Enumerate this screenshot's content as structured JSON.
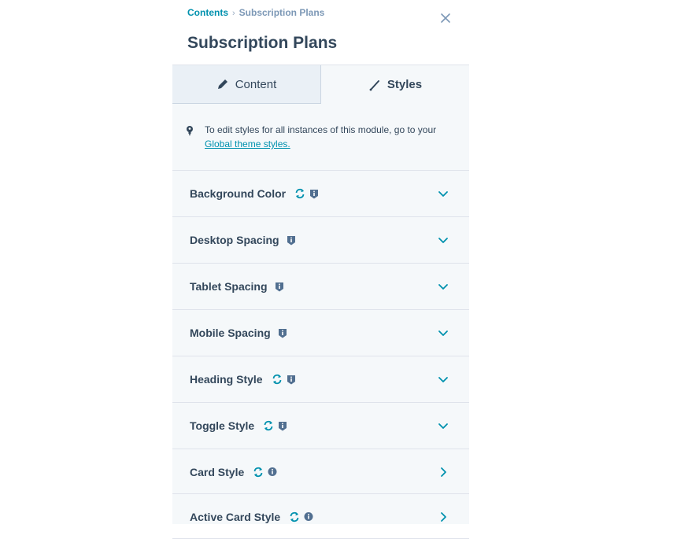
{
  "breadcrumb": {
    "parent": "Contents",
    "separator": "›",
    "current": "Subscription Plans"
  },
  "title": "Subscription Plans",
  "close_icon": "close-icon",
  "tabs": [
    {
      "label": "Content",
      "icon": "pencil-icon",
      "active": false
    },
    {
      "label": "Styles",
      "icon": "brush-icon",
      "active": true
    }
  ],
  "notice": {
    "icon": "lightbulb-icon",
    "text": "To edit styles for all instances of this module, go to your ",
    "link": "Global theme styles."
  },
  "sections": [
    {
      "label": "Background Color",
      "sync": true,
      "info": true,
      "expand": "chevron-down"
    },
    {
      "label": "Desktop Spacing",
      "sync": false,
      "info": true,
      "expand": "chevron-down"
    },
    {
      "label": "Tablet Spacing",
      "sync": false,
      "info": true,
      "expand": "chevron-down"
    },
    {
      "label": "Mobile Spacing",
      "sync": false,
      "info": true,
      "expand": "chevron-down"
    },
    {
      "label": "Heading Style",
      "sync": true,
      "info": true,
      "expand": "chevron-down"
    },
    {
      "label": "Toggle Style",
      "sync": true,
      "info": true,
      "expand": "chevron-down"
    },
    {
      "label": "Card Style",
      "sync": true,
      "info": true,
      "expand": "chevron-right"
    },
    {
      "label": "Active Card Style",
      "sync": true,
      "info": true,
      "expand": "chevron-right"
    }
  ],
  "colors": {
    "link": "#0091ae",
    "text": "#33475b",
    "muted": "#7c98b6",
    "panel_bg": "#f5f8fa",
    "inactive_tab_bg": "#eaf0f6",
    "info_icon": "#516f90"
  }
}
